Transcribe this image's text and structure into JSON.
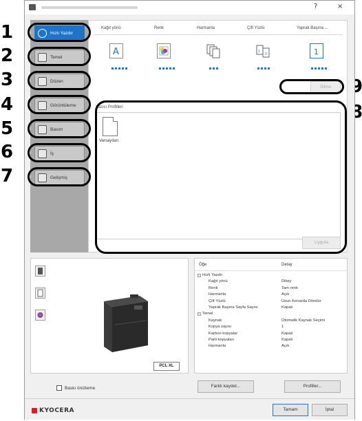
{
  "window": {
    "title": "",
    "help_button": "?",
    "close_button": "×"
  },
  "callouts": [
    "1",
    "2",
    "3",
    "4",
    "5",
    "6",
    "7",
    "8",
    "9"
  ],
  "sidebar": {
    "items": [
      {
        "label": "Hızlı Yazdır",
        "icon": "clock-icon",
        "active": true
      },
      {
        "label": "Temel",
        "icon": "document-icon",
        "active": false
      },
      {
        "label": "Düzen",
        "icon": "layout-icon",
        "active": false
      },
      {
        "label": "Görüntüleme",
        "icon": "image-icon",
        "active": false
      },
      {
        "label": "Basım",
        "icon": "booklet-icon",
        "active": false
      },
      {
        "label": "İş",
        "icon": "printer-job-icon",
        "active": false
      },
      {
        "label": "Gelişmiş",
        "icon": "advanced-icon",
        "active": false
      }
    ]
  },
  "quick_print": {
    "columns": [
      {
        "label": "Kağıt yönü",
        "icon": "portrait-a-icon"
      },
      {
        "label": "Renk",
        "icon": "color-icon"
      },
      {
        "label": "Harmanla",
        "icon": "collate-icon"
      },
      {
        "label": "Çift Yüzlü",
        "icon": "duplex-icon"
      },
      {
        "label": "Yaprak Başına ...",
        "icon": "pages-per-sheet-icon"
      }
    ],
    "delete_button": "Silme"
  },
  "profiles": {
    "label": "Yazıcı Profilleri",
    "items": [
      {
        "name": "Varsayılan",
        "icon": "blank-document-icon"
      }
    ],
    "apply_button": "Uygula"
  },
  "details": {
    "headers": {
      "item": "Öğe",
      "value": "Detay"
    },
    "rows": [
      {
        "key": "Hızlı Yazdır",
        "value": "",
        "group": true,
        "expander": "−"
      },
      {
        "key": "Kağıt yönü",
        "value": "Dikey",
        "group": false
      },
      {
        "key": "Renk",
        "value": "Tam renk",
        "group": false
      },
      {
        "key": "Harmanla",
        "value": "Açık",
        "group": false
      },
      {
        "key": "Çift Yüzlü",
        "value": "Uzun Kenarda Döndür",
        "group": false
      },
      {
        "key": "Yaprak Başına Sayfa Sayısı",
        "value": "Kapalı",
        "group": false
      },
      {
        "key": "Temel",
        "value": "",
        "group": true,
        "expander": "−"
      },
      {
        "key": "Kaynak",
        "value": "Otomatik Kaynak Seçimi",
        "group": false
      },
      {
        "key": "Kopya sayısı",
        "value": "1",
        "group": false
      },
      {
        "key": "Karbon kopyalar",
        "value": "Kapalı",
        "group": false
      },
      {
        "key": "Parti kopyaları",
        "value": "Kapalı",
        "group": false
      },
      {
        "key": "Harmanla",
        "value": "Açık",
        "group": false
      }
    ]
  },
  "preview": {
    "badge": "PCL XL",
    "checkbox_label": "Baskı önizleme",
    "tab_icons": [
      "printer-preview-icon",
      "document-preview-icon",
      "color-preview-icon"
    ]
  },
  "bottom_buttons": {
    "save_as": "Farklı kaydet...",
    "profiles": "Profiller..."
  },
  "footer": {
    "brand": "KYOCERA",
    "ok": "Tamam",
    "cancel": "İptal"
  },
  "colors": {
    "accent": "#1e74c8",
    "brand": "#d3202a",
    "sidebar": "#a8a8a8"
  }
}
